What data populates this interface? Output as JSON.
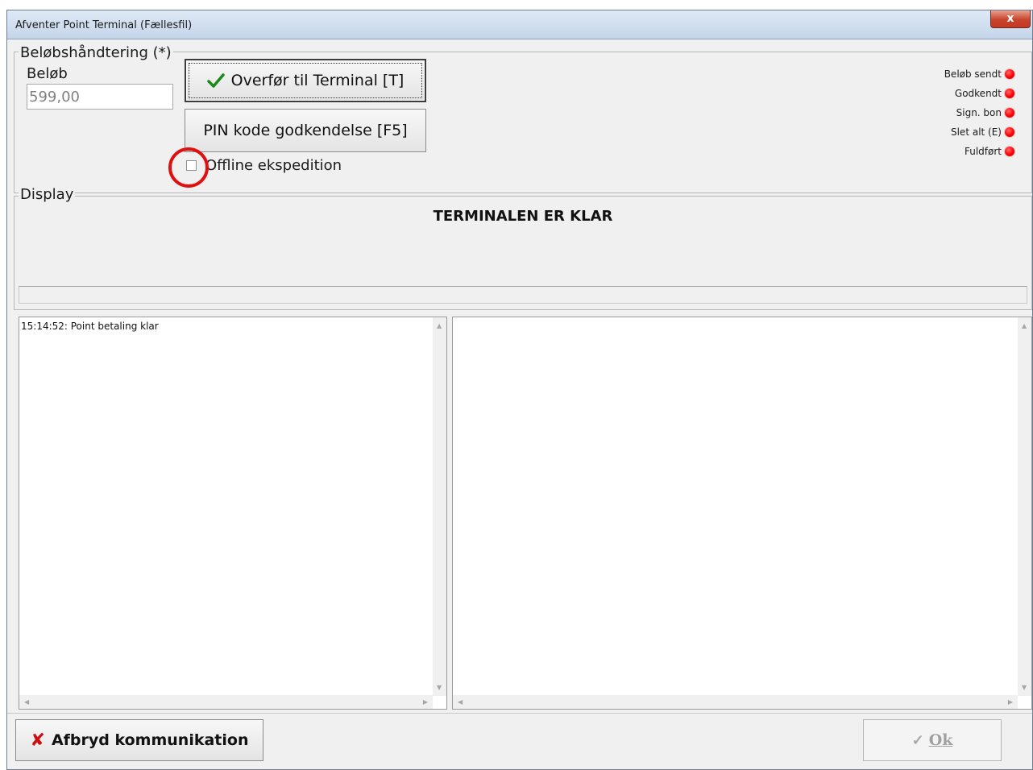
{
  "window": {
    "title": "Afventer Point Terminal (Fællesfil)",
    "close_label": "x"
  },
  "amount_group": {
    "legend": "Beløbshåndtering (*)",
    "amount_label": "Beløb",
    "amount_value": "599,00",
    "transfer_label": "Overfør til Terminal [T]",
    "pin_label": "PIN kode godkendelse [F5]",
    "offline_label": "Offline ekspedition",
    "offline_checked": false
  },
  "status_leds": [
    {
      "label": "Beløb sendt",
      "color": "#ff0000"
    },
    {
      "label": "Godkendt",
      "color": "#ff0000"
    },
    {
      "label": "Sign. bon",
      "color": "#ff0000"
    },
    {
      "label": "Slet alt (E)",
      "color": "#ff0000"
    },
    {
      "label": "Fuldført",
      "color": "#ff0000"
    }
  ],
  "display_group": {
    "legend": "Display",
    "message": "TERMINALEN ER KLAR"
  },
  "log": {
    "entries": [
      "15:14:52: Point betaling klar"
    ]
  },
  "footer": {
    "abort_label": "Afbryd kommunikation",
    "ok_label": "Ok"
  },
  "colors": {
    "accent_check": "#1a8a1a",
    "abort_x": "#cc1010",
    "led": "#ff0000",
    "highlight_circle": "#e01010"
  }
}
